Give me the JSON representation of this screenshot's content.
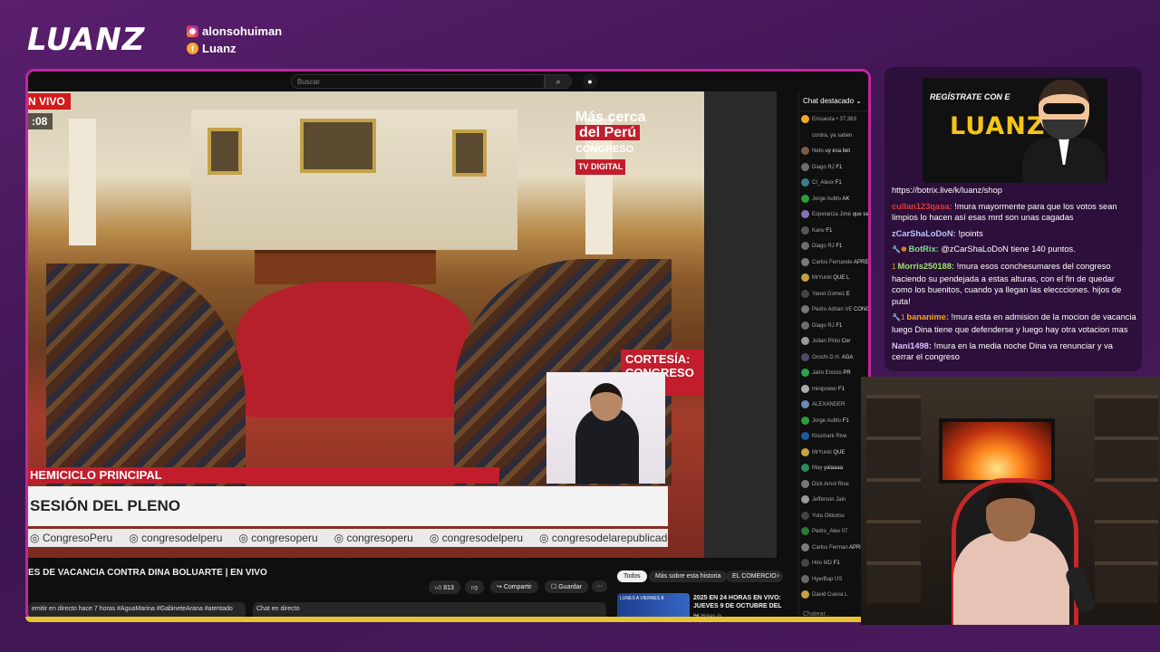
{
  "header": {
    "brand": "LUANZ",
    "instagram": "alonsohuiman",
    "facebook": "Luanz"
  },
  "browser": {
    "search_placeholder": "Buscar",
    "search_icon": "search-icon",
    "mic_icon": "mic-icon"
  },
  "video": {
    "live_badge": "N VIVO",
    "timer": ":08",
    "overlay_line1": "Más cerca",
    "overlay_line2": "del Perú",
    "overlay_channel": "CONGRESO",
    "overlay_tv": "TV DIGITAL",
    "cortesia": "CORTESÍA: CONGRESO TV",
    "lower_third_top": "HEMICICLO PRINCIPAL",
    "lower_third_main": "SESIÓN DEL PLENO",
    "socials": [
      "CongresoPeru",
      "congresodelperu",
      "congresoperu",
      "congresoperu",
      "congresodelperu",
      "congresodelarepublicadelperu"
    ]
  },
  "below": {
    "title": "ES DE VACANCIA CONTRA DINA BOLUARTE | EN VIVO",
    "likes": "813",
    "share": "Compartir",
    "save": "Guardar",
    "more": "···",
    "description": "emitir en directo hace 7 horas  #AguaMarina #GabineteArana #atentado",
    "chat_live": "Chat en directo",
    "chips": [
      "Todos",
      "Más sobre esta historia",
      "EL COMERCIO"
    ],
    "rec_thumb": "LUNES A VIERNES 8",
    "rec_title": "2025 EN 24 HORAS EN VIVO: JUEVES 9 DE OCTUBRE DEL ...",
    "rec_meta": "24 Horas ◎"
  },
  "ytchat": {
    "header": "Chat destacado",
    "footer": "Chatear...",
    "rows": [
      {
        "name": "Encuesta • 37.363",
        "text": "",
        "color": "#f5a623"
      },
      {
        "name": "contra, ya saben",
        "text": "",
        "color": "#0f0f0f"
      },
      {
        "name": "Neto",
        "text": "uy esa bet",
        "color": "#7b5b4b"
      },
      {
        "name": "Diago RJ",
        "text": "F1",
        "color": "#6d6d6d"
      },
      {
        "name": "CI_Alexx",
        "text": "F1",
        "color": "#3b7b8b"
      },
      {
        "name": "Jorge AuMo",
        "text": "AK",
        "color": "#2a9d3a"
      },
      {
        "name": "Esperanza Jimé",
        "text": "que ser venezu",
        "color": "#8a6fb5"
      },
      {
        "name": "Kanv",
        "text": "F1",
        "color": "#555"
      },
      {
        "name": "Diago RJ",
        "text": "F1",
        "color": "#6d6d6d"
      },
      {
        "name": "Carlos Fernande",
        "text": "APRESADA PAR",
        "color": "#7a7a7a"
      },
      {
        "name": "MrYunki",
        "text": "QUE L",
        "color": "#c8a040"
      },
      {
        "name": "Yanet Gomez",
        "text": "E",
        "color": "#444"
      },
      {
        "name": "Pedro Adrian VE",
        "text": "CONGRESISTAS",
        "color": "#777"
      },
      {
        "name": "Diago RJ",
        "text": "F1",
        "color": "#6d6d6d"
      },
      {
        "name": "Julian Pinto",
        "text": "Cor",
        "color": "#999"
      },
      {
        "name": "Orochi D.H.",
        "text": "AGA",
        "color": "#4a4a6a"
      },
      {
        "name": "Jairo Enciso",
        "text": "PR",
        "color": "#2aa24a"
      },
      {
        "name": "minipower",
        "text": "F1",
        "color": "#aaa"
      },
      {
        "name": "ALEXANDER",
        "text": "",
        "color": "#6a8ab5"
      },
      {
        "name": "Jorge AuMo",
        "text": "F1",
        "color": "#2a9d3a"
      },
      {
        "name": "Kissmark Rive",
        "text": "",
        "color": "#1d5aa0"
      },
      {
        "name": "MrYunki",
        "text": "QUE",
        "color": "#c8a040"
      },
      {
        "name": "May",
        "text": "yalaaaa",
        "color": "#2a8a5a"
      },
      {
        "name": "Dick Arnol Rive",
        "text": "",
        "color": "#777"
      },
      {
        "name": "Jefferson Jain",
        "text": "",
        "color": "#999"
      },
      {
        "name": "Yuta Okkotsu",
        "text": "",
        "color": "#444"
      },
      {
        "name": "Pedro_Alex 07",
        "text": "",
        "color": "#2a7a3a"
      },
      {
        "name": "Carlos Ferman",
        "text": "APRESADA PA",
        "color": "#7a7a7a"
      },
      {
        "name": "Hiro MD",
        "text": "F1",
        "color": "#444"
      },
      {
        "name": "HyerBap US",
        "text": "",
        "color": "#666"
      },
      {
        "name": "David Cueva L",
        "text": "",
        "color": "#c8a040"
      }
    ]
  },
  "panel": {
    "banner_text": "REGÍSTRATE CON E",
    "banner_brand": "LUANZ",
    "messages": [
      {
        "user": "",
        "text": "https://botrix.live/k/luanz/shop",
        "user_color": "#ffffff",
        "badge": ""
      },
      {
        "user": "cullan123qasa:",
        "text": " !mura mayormente para que los votos sean limpios lo hacen así esas mrd son unas cagadas",
        "user_color": "#e03a3a",
        "badge": ""
      },
      {
        "user": "zCarShaLoDoN:",
        "text": " !points",
        "user_color": "#b8c8ff",
        "badge": ""
      },
      {
        "user": "BotRix:",
        "text": " @zCarShaLoDoN tiene 140 puntos.",
        "user_color": "#7ee08a",
        "badge": "🔧✽"
      },
      {
        "user": "Morris250188:",
        "text": " !mura esos conchesumares del congreso haciendo su pendejada a estas alturas, con el fin de quedar como los buenitos, cuando ya llegan las eleccciones. hijos de puta!",
        "user_color": "#9de66a",
        "badge": "1"
      },
      {
        "user": "bananime:",
        "text": " !mura esta en admision de la mocion de vacancia luego Dina tiene que defenderse y luego hay otra votacion mas",
        "user_color": "#f5a623",
        "badge": "🔧1"
      },
      {
        "user": "Nani1498:",
        "text": " !mura en la media noche Dina va renunciar y va cerrar el congreso",
        "user_color": "#d7c6ff",
        "badge": ""
      }
    ]
  }
}
